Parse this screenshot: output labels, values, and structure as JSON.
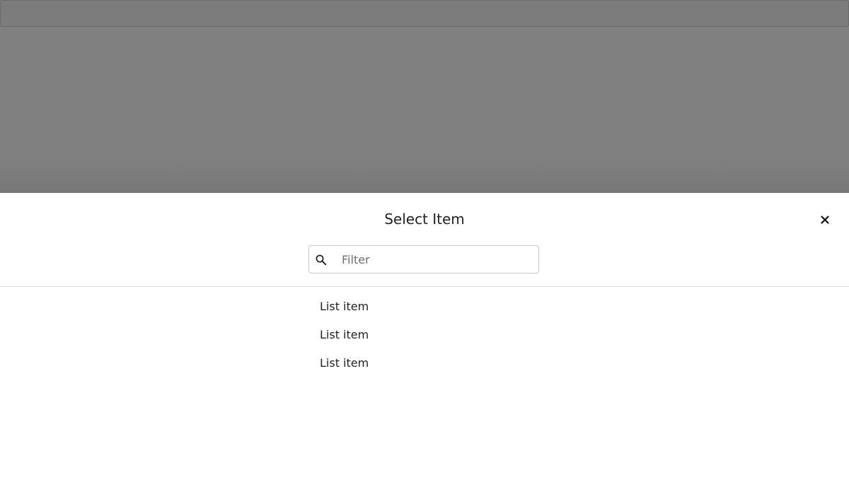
{
  "sheet": {
    "title": "Select Item",
    "close_icon": "close-icon",
    "filter": {
      "icon": "search-icon",
      "placeholder": "Filter",
      "value": ""
    },
    "items": [
      {
        "label": "List item"
      },
      {
        "label": "List item"
      },
      {
        "label": "List item"
      }
    ]
  },
  "colors": {
    "backdrop": "#808080",
    "sheet_background": "#ffffff",
    "text": "#222222",
    "divider": "#d9d9d9"
  }
}
